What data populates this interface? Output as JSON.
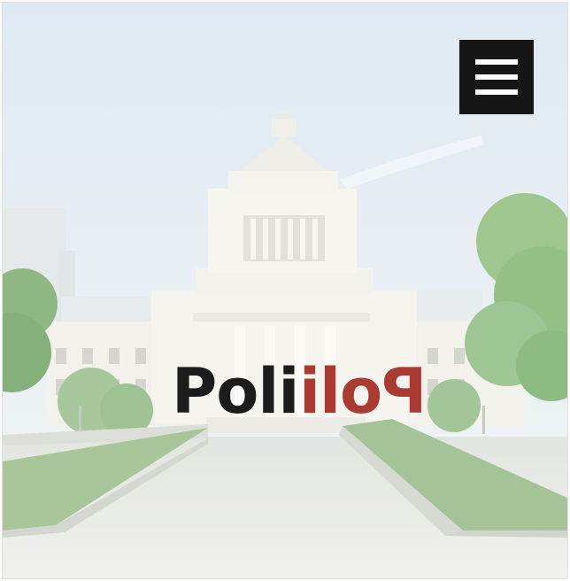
{
  "logo": {
    "text_dark": "Poli",
    "text_red": "Poli",
    "colors": {
      "dark": "#1c1c1c",
      "red": "#a93b33"
    }
  },
  "menu": {
    "icon": "hamburger-menu-icon",
    "background": "#161616"
  },
  "hero": {
    "subject": "parliament-building-photo"
  }
}
